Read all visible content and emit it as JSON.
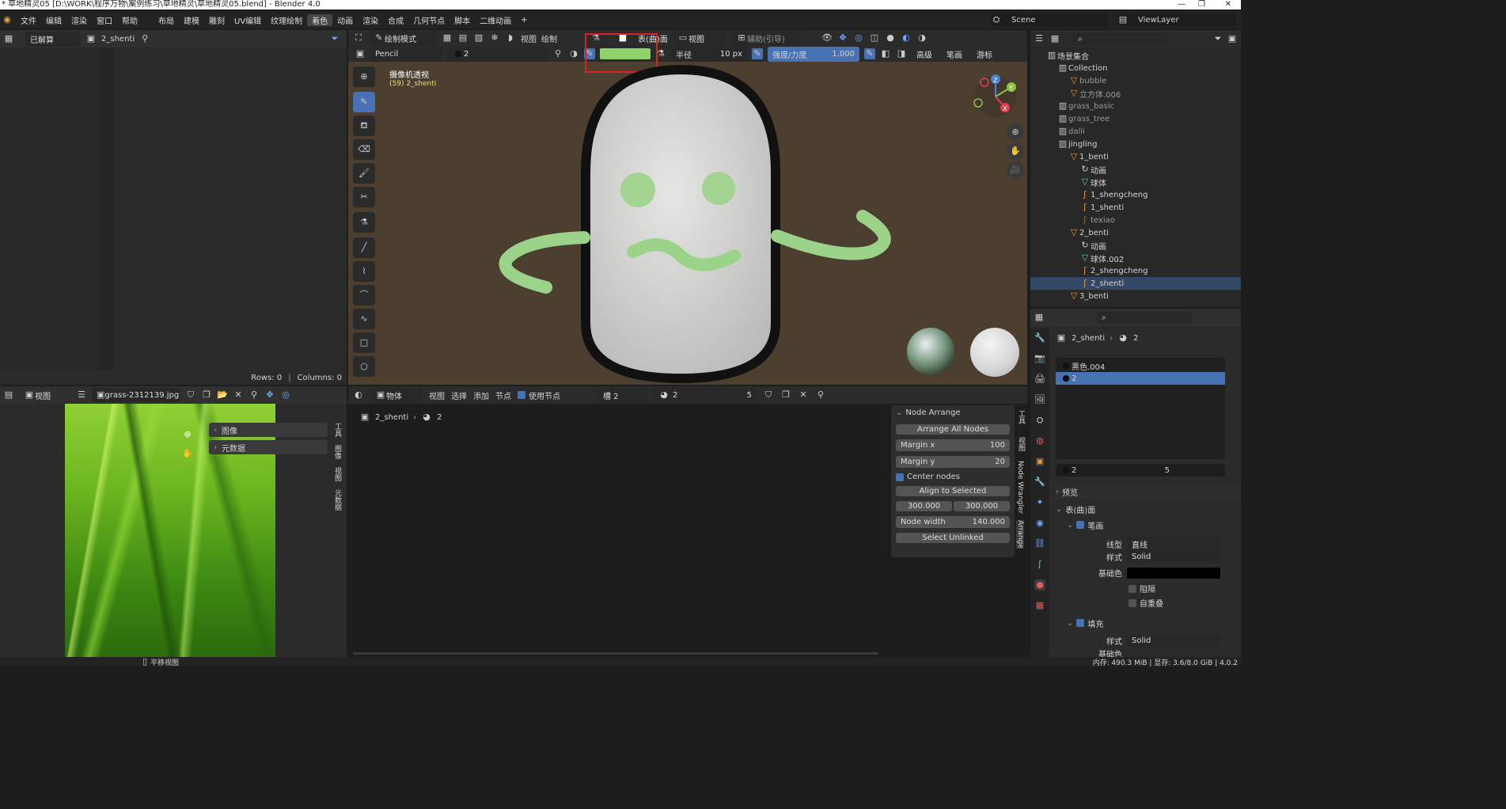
{
  "window": {
    "title": "* 草地精灵05 [D:\\WORK\\程序万物\\案例练习\\草地精灵\\草地精灵05.blend] - Blender 4.0"
  },
  "menu": [
    "文件",
    "编辑",
    "渲染",
    "窗口",
    "帮助"
  ],
  "workspaces": [
    "布局",
    "建模",
    "雕刻",
    "UV编辑",
    "纹理绘制",
    "着色",
    "动画",
    "渲染",
    "合成",
    "几何节点",
    "脚本",
    "二维动画"
  ],
  "scene": "Scene",
  "view_layer": "ViewLayer",
  "topleft": {
    "mode": "已解算",
    "object": "2_shenti",
    "rows": "Rows: 0",
    "columns": "Columns: 0"
  },
  "viewport": {
    "mode": "绘制模式",
    "menus": [
      "视图",
      "绘制"
    ],
    "brush": "Pencil",
    "material_slot": "2",
    "color_hex": "#8fd16a",
    "stroke_placement": "表(曲)面",
    "view": "视图",
    "guides": "辅助(引导)",
    "radius_label": "半径",
    "radius_value": "10 px",
    "strength_label": "强度/力度",
    "strength_value": "1.000",
    "advanced": "高级",
    "stroke": "笔画",
    "cursor": "游标",
    "camera_title": "摄像机透视",
    "camera_sub": "(59) 2_shenti"
  },
  "outliner": {
    "title": "场景集合",
    "items": [
      {
        "label": "Collection"
      },
      {
        "label": "bubble"
      },
      {
        "label": "立方体.006"
      },
      {
        "label": "grass_basic"
      },
      {
        "label": "grass_tree"
      },
      {
        "label": "dalli"
      },
      {
        "label": "jingling"
      },
      {
        "label": "1_benti"
      },
      {
        "label": "动画"
      },
      {
        "label": "球体"
      },
      {
        "label": "1_shengcheng"
      },
      {
        "label": "1_shenti"
      },
      {
        "label": "texiao"
      },
      {
        "label": "2_benti"
      },
      {
        "label": "动画"
      },
      {
        "label": "球体.002"
      },
      {
        "label": "2_shengcheng"
      },
      {
        "label": "2_shenti"
      },
      {
        "label": "3_benti"
      }
    ]
  },
  "properties": {
    "breadcrumb_object": "2_shenti",
    "breadcrumb_material": "2",
    "materials": [
      "黑色.004",
      "2"
    ],
    "selected_material": "2",
    "users": "5",
    "sections": {
      "preview": "预览",
      "surface": "表(曲)面",
      "stroke": "笔画",
      "fill": "填充"
    },
    "line_type_label": "线型",
    "line_type_value": "直线",
    "style_label": "样式",
    "style_value": "Solid",
    "base_color_label": "基础色",
    "holdout_label": "阻隔",
    "self_overlap_label": "自重叠",
    "fill_style_label": "样式",
    "fill_style_value": "Solid",
    "fill_color_label": "基础色"
  },
  "image_editor": {
    "view": "视图",
    "image_name": "grass-2312139.jpg",
    "panels": [
      "图像",
      "元数据"
    ],
    "tabs": [
      "工具",
      "图像",
      "视图",
      "元数据"
    ]
  },
  "node_editor": {
    "object_mode": "物体",
    "menus": [
      "视图",
      "选择",
      "添加",
      "节点"
    ],
    "use_nodes": "使用节点",
    "slot": "槽 2",
    "material": "2",
    "users": "5",
    "breadcrumb_object": "2_shenti",
    "breadcrumb_material": "2",
    "panel_title": "Node Arrange",
    "arrange_all": "Arrange All Nodes",
    "margin_x_label": "Margin x",
    "margin_x_value": "100",
    "margin_y_label": "Margin y",
    "margin_y_value": "20",
    "center_nodes": "Center nodes",
    "align_selected": "Align to Selected",
    "val_a": "300.000",
    "val_b": "300.000",
    "node_width_label": "Node width",
    "node_width_value": "140.000",
    "select_unlinked": "Select Unlinked",
    "side_tabs": [
      "Arrange",
      "Node Wrangler",
      "视图",
      "工具"
    ]
  },
  "status": {
    "left": "平移视图",
    "right": "内存: 490.3 MiB | 显存: 3.6/8.0 GiB | 4.0.2"
  }
}
